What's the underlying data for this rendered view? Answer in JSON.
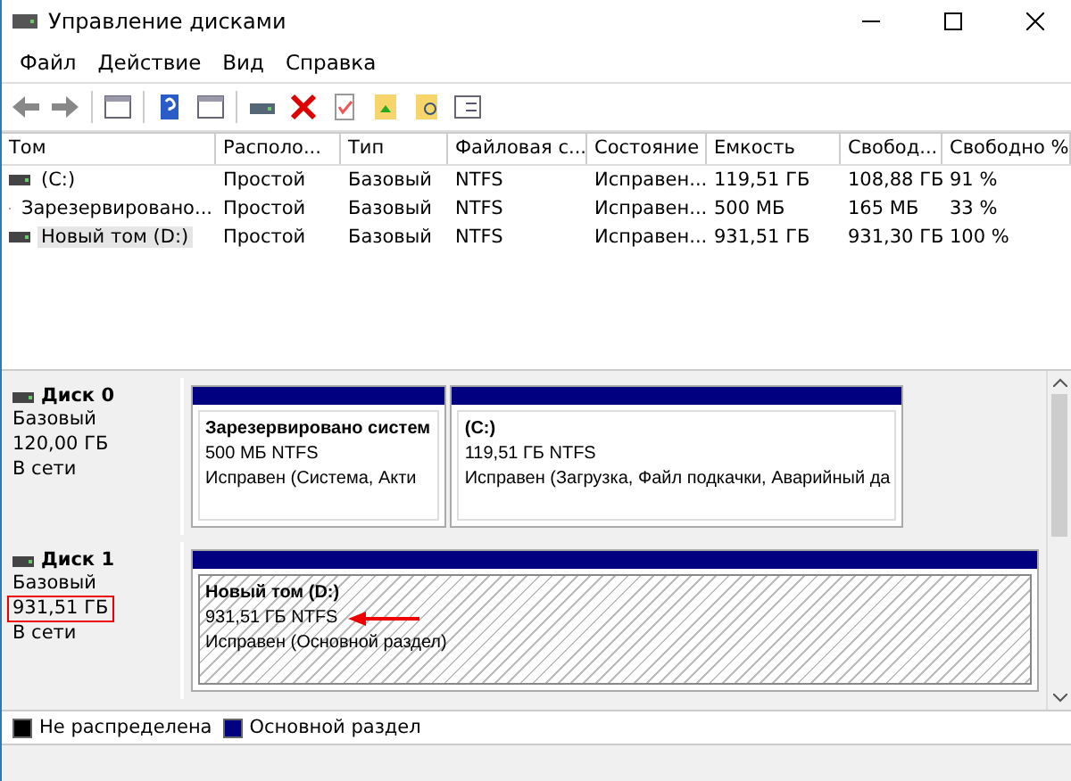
{
  "window": {
    "title": "Управление дисками"
  },
  "menu": [
    "Файл",
    "Действие",
    "Вид",
    "Справка"
  ],
  "table": {
    "columns": [
      "Том",
      "Располо...",
      "Тип",
      "Файловая с...",
      "Состояние",
      "Емкость",
      "Свобод...",
      "Свободно %"
    ],
    "rows": [
      {
        "cells": [
          "(C:)",
          "Простой",
          "Базовый",
          "NTFS",
          "Исправен...",
          "119,51 ГБ",
          "108,88 ГБ",
          "91 %"
        ],
        "selected": false
      },
      {
        "cells": [
          "Зарезервировано...",
          "Простой",
          "Базовый",
          "NTFS",
          "Исправен...",
          "500 МБ",
          "165 МБ",
          "33 %"
        ],
        "selected": false
      },
      {
        "cells": [
          "Новый том (D:)",
          "Простой",
          "Базовый",
          "NTFS",
          "Исправен...",
          "931,51 ГБ",
          "931,30 ГБ",
          "100 %"
        ],
        "selected": true
      }
    ]
  },
  "disks": [
    {
      "name": "Диск 0",
      "type": "Базовый",
      "capacity": "120,00 ГБ",
      "capacity_highlighted": false,
      "status": "В сети",
      "partitions": [
        {
          "name": "Зарезервировано систем",
          "size": "500 МБ NTFS",
          "status": "Исправен (Система, Акти",
          "selected": false
        },
        {
          "name": "(C:)",
          "size": "119,51 ГБ NTFS",
          "status": "Исправен (Загрузка, Файл подкачки, Аварийный да",
          "selected": false
        }
      ]
    },
    {
      "name": "Диск 1",
      "type": "Базовый",
      "capacity": "931,51 ГБ",
      "capacity_highlighted": true,
      "status": "В сети",
      "partitions": [
        {
          "name": "Новый том  (D:)",
          "size": "931,51 ГБ NTFS",
          "status": "Исправен (Основной раздел)",
          "selected": true,
          "annotated": true
        }
      ]
    }
  ],
  "legend": [
    {
      "label": "Не распределена",
      "color": "#000000"
    },
    {
      "label": "Основной раздел",
      "color": "#000080"
    }
  ]
}
